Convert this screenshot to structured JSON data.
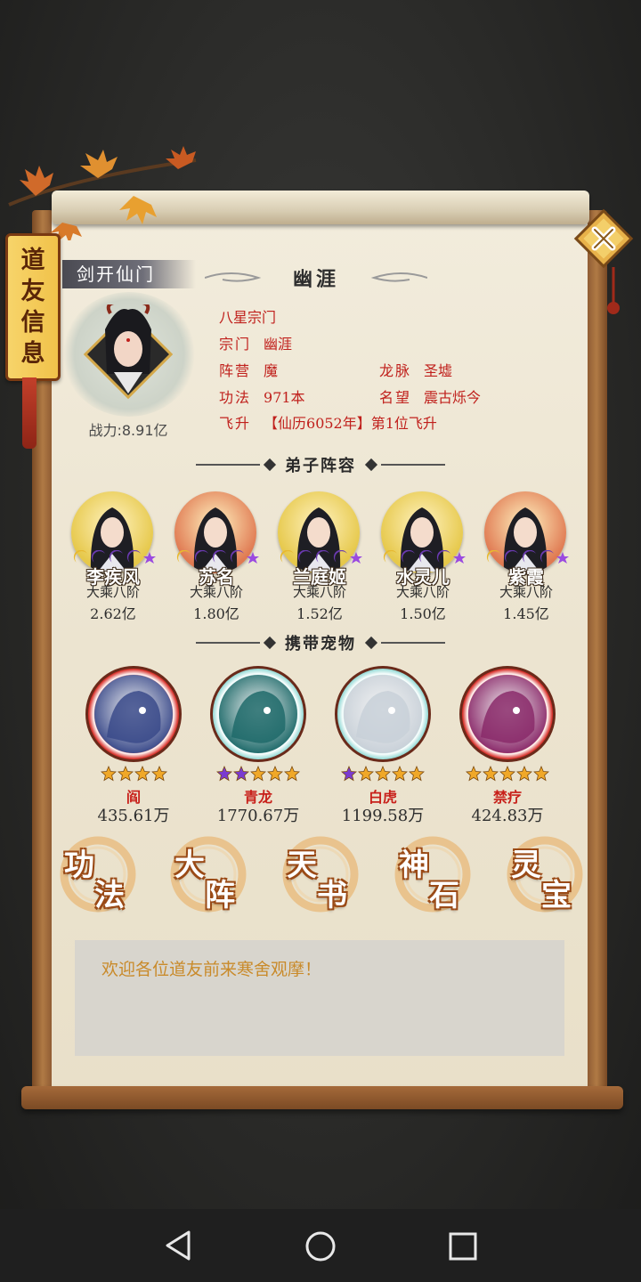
{
  "banner": {
    "chars": [
      "道",
      "友",
      "信",
      "息"
    ]
  },
  "header": {
    "sect_tag": "剑开仙门",
    "player_name": "幽涯"
  },
  "player": {
    "power_label": "战力:8.91亿",
    "rank": "八星宗门",
    "sect_key": "宗门",
    "sect_val": "幽涯",
    "camp_key": "阵营",
    "camp_val": "魔",
    "vein_key": "龙脉",
    "vein_val": "圣墟",
    "method_key": "功法",
    "method_val": "971本",
    "fame_key": "名望",
    "fame_val": "震古烁今",
    "ascend_key": "飞升",
    "ascend_val": "【仙历6052年】第1位飞升"
  },
  "disciples_title": "弟子阵容",
  "disciples": [
    {
      "name": "李疾风",
      "rank": "大乘八阶",
      "power": "2.62亿",
      "bg": "#e6c84a"
    },
    {
      "name": "苏名",
      "rank": "大乘八阶",
      "power": "1.80亿",
      "bg": "#e07a52"
    },
    {
      "name": "兰庭姬",
      "rank": "大乘八阶",
      "power": "1.52亿",
      "bg": "#e6c84a"
    },
    {
      "name": "水灵儿",
      "rank": "大乘八阶",
      "power": "1.50亿",
      "bg": "#e6c84a"
    },
    {
      "name": "紫霞",
      "rank": "大乘八阶",
      "power": "1.45亿",
      "bg": "#e07a52"
    }
  ],
  "pets_title": "携带宠物",
  "pets": [
    {
      "name": "阎",
      "power": "435.61万",
      "ring": "#d8302a",
      "stars": [
        "gold",
        "gold",
        "gold",
        "gold"
      ],
      "art": "#3a4a8a"
    },
    {
      "name": "青龙",
      "power": "1770.67万",
      "ring": "#9adcd8",
      "stars": [
        "purple",
        "purple",
        "gold",
        "gold",
        "gold"
      ],
      "art": "#1e6a6a"
    },
    {
      "name": "白虎",
      "power": "1199.58万",
      "ring": "#9adcd8",
      "stars": [
        "purple",
        "gold",
        "gold",
        "gold",
        "gold"
      ],
      "art": "#c8d0d8"
    },
    {
      "name": "禁疗",
      "power": "424.83万",
      "ring": "#d8302a",
      "stars": [
        "gold",
        "gold",
        "gold",
        "gold",
        "gold"
      ],
      "art": "#8a2a6a"
    }
  ],
  "functions": [
    {
      "c1": "功",
      "c2": "法"
    },
    {
      "c1": "大",
      "c2": "阵"
    },
    {
      "c1": "天",
      "c2": "书"
    },
    {
      "c1": "神",
      "c2": "石"
    },
    {
      "c1": "灵",
      "c2": "宝"
    }
  ],
  "message": "欢迎各位道友前来寒舍观摩！"
}
